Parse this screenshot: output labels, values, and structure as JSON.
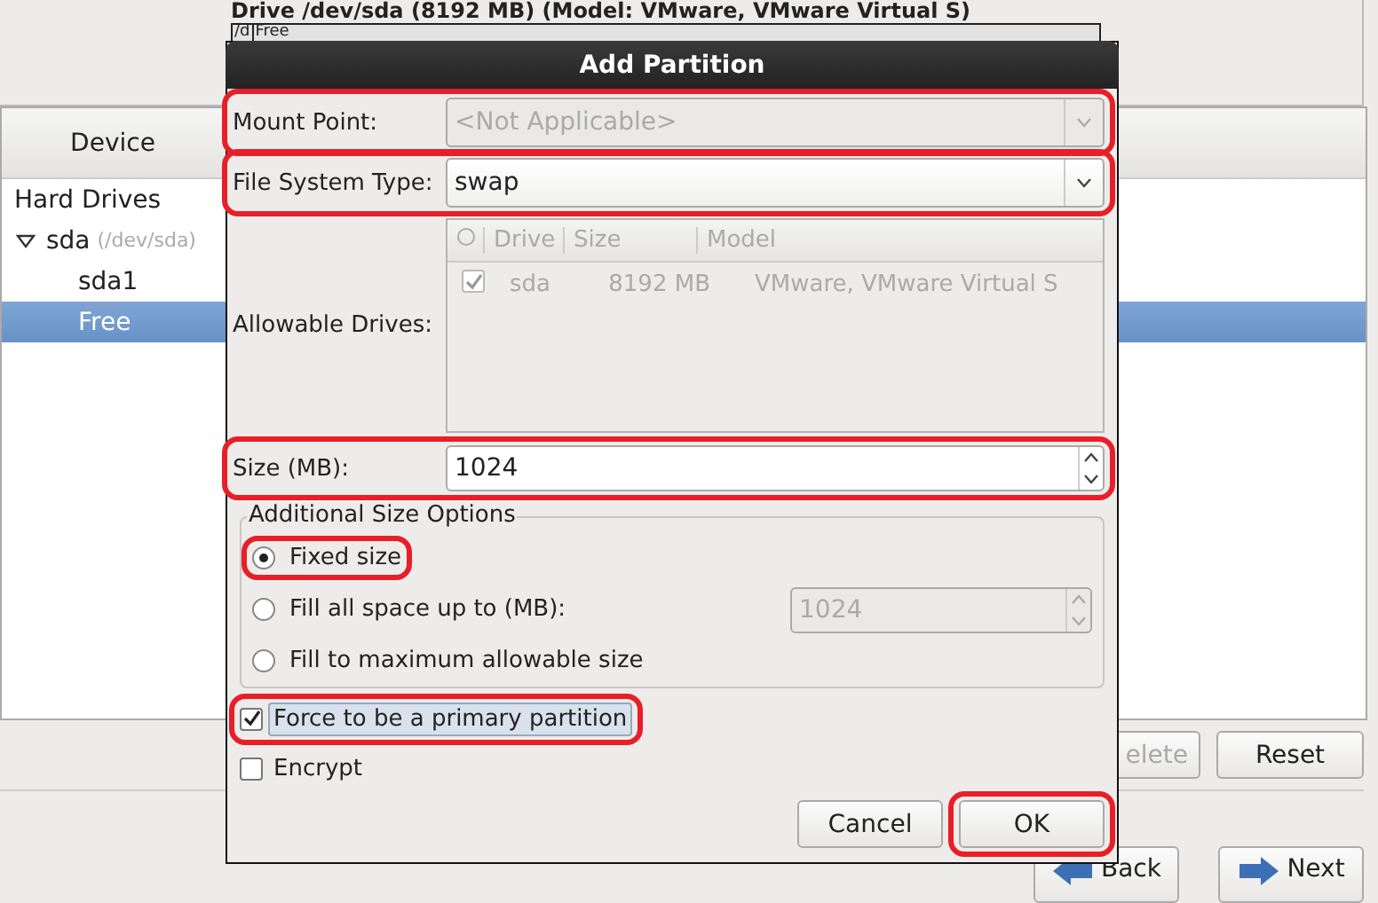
{
  "background": {
    "drive_heading": "Drive /dev/sda (8192 MB) (Model: VMware, VMware Virtual S)",
    "partition_bar": [
      {
        "label": "/d"
      },
      {
        "label": "Free"
      }
    ],
    "device_table": {
      "column": "Device",
      "rows": [
        {
          "label": "Hard Drives",
          "selected": false
        },
        {
          "label": "sda",
          "detail": "(/dev/sda)",
          "expanded": true,
          "selected": false,
          "children": [
            {
              "label": "sda1",
              "selected": false
            },
            {
              "label": "Free",
              "selected": true
            }
          ]
        }
      ]
    },
    "buttons": [
      {
        "label": "elete",
        "disabled": true
      },
      {
        "label": "Reset",
        "disabled": false
      }
    ],
    "nav_buttons": [
      {
        "label": "Back",
        "kind": "back"
      },
      {
        "label": "Next",
        "kind": "next"
      }
    ]
  },
  "dialog": {
    "title": "Add Partition",
    "mount_point": {
      "label": "Mount Point:",
      "value": "<Not Applicable>",
      "disabled": true,
      "highlighted": true
    },
    "file_system_type": {
      "label": "File System Type:",
      "value": "swap",
      "disabled": false,
      "highlighted": true
    },
    "allowable_drives": {
      "label": "Allowable Drives:",
      "disabled": true,
      "columns": [
        "Drive",
        "Size",
        "Model"
      ],
      "rows": [
        {
          "checked": true,
          "drive": "sda",
          "size": "8192 MB",
          "model": "VMware, VMware Virtual S"
        }
      ]
    },
    "size": {
      "label": "Size (MB):",
      "value": "1024",
      "highlighted": true
    },
    "size_options": {
      "title": "Additional Size Options",
      "options": [
        {
          "label": "Fixed size",
          "selected": true,
          "highlighted": true
        },
        {
          "label": "Fill all space up to (MB):",
          "selected": false,
          "highlighted": false,
          "spin_value": "1024",
          "spin_disabled": true
        },
        {
          "label": "Fill to maximum allowable size",
          "selected": false,
          "highlighted": false
        }
      ]
    },
    "checkboxes": [
      {
        "label": "Force to be a primary partition",
        "checked": true,
        "focused": true,
        "highlighted": true
      },
      {
        "label": "Encrypt",
        "checked": false,
        "focused": false,
        "highlighted": false
      }
    ],
    "buttons": [
      {
        "label": "Cancel",
        "highlighted": false
      },
      {
        "label": "OK",
        "highlighted": true
      }
    ]
  }
}
